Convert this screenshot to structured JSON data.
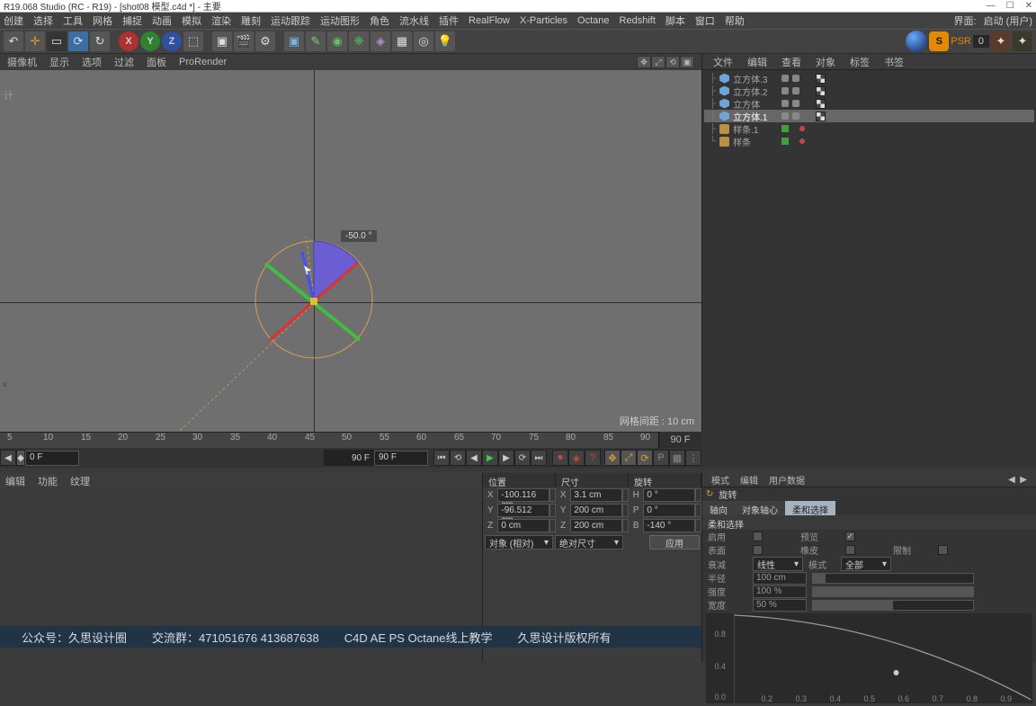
{
  "title": "R19.068 Studio (RC - R19) - [shot08 模型.c4d *] - 主要",
  "menu": [
    "创建",
    "选择",
    "工具",
    "网格",
    "捕捉",
    "动画",
    "模拟",
    "渲染",
    "雕刻",
    "运动跟踪",
    "运动图形",
    "角色",
    "流水线",
    "插件",
    "RealFlow",
    "X-Particles",
    "Octane",
    "Redshift",
    "脚本",
    "窗口",
    "帮助"
  ],
  "menu_right": {
    "a": "界面:",
    "b": "启动 (用户)"
  },
  "psr": {
    "s": "S",
    "label": "PSR",
    "zero": "0"
  },
  "view_menu": [
    "摄像机",
    "显示",
    "选项",
    "过滤",
    "面板",
    "ProRender"
  ],
  "viewport": {
    "grid_info": "网格间距 : 10 cm",
    "angle": "-50.0 °",
    "vp_label": "计",
    "axis": "x"
  },
  "obj_tabs": [
    "文件",
    "编辑",
    "查看",
    "对象",
    "标签",
    "书签"
  ],
  "objects": [
    {
      "name": "立方体.3",
      "type": "cube"
    },
    {
      "name": "立方体.2",
      "type": "cube"
    },
    {
      "name": "立方体",
      "type": "cube"
    },
    {
      "name": "立方体.1",
      "type": "cube",
      "sel": true
    },
    {
      "name": "样条.1",
      "type": "spline",
      "green": true
    },
    {
      "name": "样条",
      "type": "spline",
      "green": true
    }
  ],
  "timeline": {
    "start": "0 F",
    "end_ruler": "90 F",
    "end": "90 F",
    "ticks": [
      5,
      10,
      15,
      20,
      25,
      30,
      35,
      40,
      45,
      50,
      55,
      60,
      65,
      70,
      75,
      80,
      85,
      90
    ]
  },
  "mat_tabs": [
    "编辑",
    "功能",
    "纹理"
  ],
  "coord": {
    "hdr": [
      "位置",
      "尺寸",
      "旋转"
    ],
    "rows": [
      {
        "a": "X",
        "v1": "-100.116 cm",
        "b": "X",
        "v2": "3.1 cm",
        "c": "H",
        "v3": "0 °"
      },
      {
        "a": "Y",
        "v1": "-96.512 cm",
        "b": "Y",
        "v2": "200 cm",
        "c": "P",
        "v3": "0 °"
      },
      {
        "a": "Z",
        "v1": "0 cm",
        "b": "Z",
        "v2": "200 cm",
        "c": "B",
        "v3": "-140 °"
      }
    ],
    "dd1": "对象 (相对)",
    "dd2": "绝对尺寸",
    "btn": "应用"
  },
  "attr": {
    "tabs": [
      "模式",
      "编辑",
      "用户数据"
    ],
    "tool_ico": "↻",
    "tool": "旋转",
    "modes": [
      "轴向",
      "对象轴心",
      "柔和选择"
    ],
    "sect": "柔和选择",
    "p_enable": "启用",
    "p_preview": "预览",
    "p_surface": "表面",
    "p_rubber": "橡皮",
    "p_limit": "限制",
    "p_falloff": "衰减",
    "v_falloff": "线性",
    "p_mode": "模式",
    "v_mode": "全部",
    "p_radius": "半径",
    "v_radius": "100 cm",
    "p_strength": "强度",
    "v_strength": "100 %",
    "p_width": "宽度",
    "v_width": "50 %",
    "curve_ticks": [
      "0.2",
      "0.3",
      "0.4",
      "0.5",
      "0.6",
      "0.7",
      "0.8",
      "0.9"
    ],
    "curve_y": [
      "0.8",
      "0.4",
      "0.0"
    ]
  },
  "banner": [
    "公众号：久思设计圈",
    "交流群：471051676   413687638",
    "C4D AE PS Octane线上教学",
    "久思设计版权所有"
  ]
}
